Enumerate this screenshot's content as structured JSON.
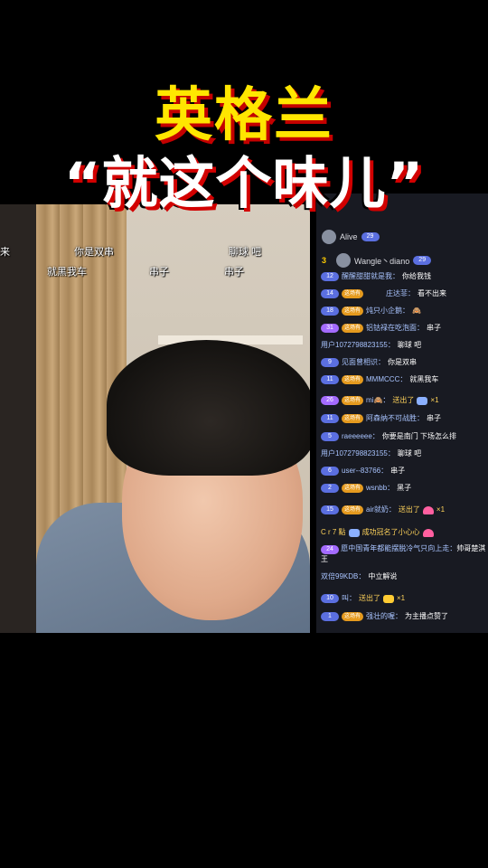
{
  "headline": {
    "line1": "英格兰",
    "line2": "“就这个味儿”"
  },
  "video": {
    "danmaku": [
      {
        "text": "来"
      },
      {
        "text": "你是双串"
      },
      {
        "text": "聊球 吧"
      },
      {
        "text": "就黑我车"
      },
      {
        "text": "串子"
      },
      {
        "text": "串子"
      }
    ]
  },
  "chat": {
    "ranks": [
      {
        "rank": "",
        "name": "Alive",
        "level": "29"
      },
      {
        "rank": "3",
        "name": "Wangle丶diano",
        "level": "29"
      }
    ],
    "messages": [
      {
        "level": "12",
        "fan": "",
        "user": "醒醒甜甜就是我：",
        "text": "你给我钱"
      },
      {
        "level": "14",
        "fan": "这场有",
        "user": "庄达菲：",
        "text": "看不出来"
      },
      {
        "level": "18",
        "fan": "这场有",
        "user": "炖只小企鹅：",
        "text": "🙈"
      },
      {
        "level": "31",
        "fan": "这场有",
        "user": "铝钴禄在吃泡面：",
        "text": "串子"
      },
      {
        "level": "",
        "fan": "",
        "user": "用户1072798823155：",
        "text": "聊球 吧"
      },
      {
        "level": "9",
        "fan": "",
        "user": "见面曾相识：",
        "text": "你是双串"
      },
      {
        "level": "11",
        "fan": "这场有",
        "user": "MMMCCC：",
        "text": "就黑我车"
      },
      {
        "level": "26",
        "fan": "这场有",
        "user": "mi🙈：",
        "text": "送出了",
        "gift": "×1"
      },
      {
        "level": "11",
        "fan": "这场有",
        "user": "阿森纳不可战胜：",
        "text": "串子"
      },
      {
        "level": "5",
        "fan": "",
        "user": "raeeeeee：",
        "text": "你要是南门 下场怎么排"
      },
      {
        "level": "",
        "fan": "",
        "user": "用户1072798823155：",
        "text": "聊球 吧"
      },
      {
        "level": "6",
        "fan": "",
        "user": "user--83766：",
        "text": "串子"
      },
      {
        "level": "2",
        "fan": "这场有",
        "user": "wsnbb：",
        "text": "黑子"
      },
      {
        "level": "15",
        "fan": "这场有",
        "user": "air就奶：",
        "text": "送出了",
        "gift": "×1"
      },
      {
        "level": "",
        "fan": "",
        "user": "C r 7 點",
        "text": "成功冠名了小心心"
      },
      {
        "level": "24",
        "fan": "",
        "user": "愿中国青年都能摆脱冷气只向上走：",
        "text": "帅哥楚淇王"
      },
      {
        "level": "",
        "fan": "",
        "user": "双倍99KDB：",
        "text": "中立解说"
      },
      {
        "level": "10",
        "fan": "",
        "user": "叫：",
        "text": "送出了",
        "gift": "×1"
      },
      {
        "level": "1",
        "fan": "这场有",
        "user": "强壮的喔：",
        "text": "为主播点赞了"
      }
    ]
  }
}
